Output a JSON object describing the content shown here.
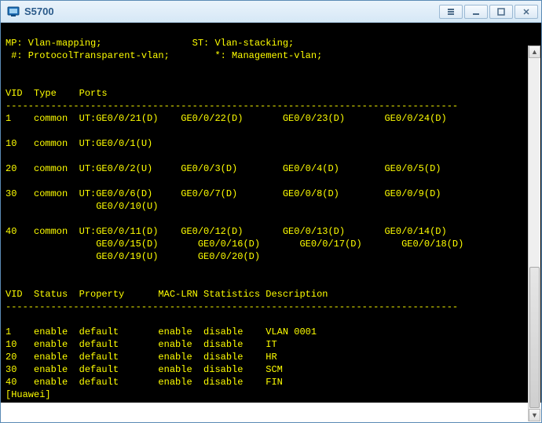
{
  "window": {
    "title": "S5700"
  },
  "legend": {
    "line1_left": "MP: Vlan-mapping;",
    "line1_right": "ST: Vlan-stacking;",
    "line2_left": "#: ProtocolTransparent-vlan;",
    "line2_right": "*: Management-vlan;"
  },
  "table1": {
    "headers": {
      "vid": "VID",
      "type": "Type",
      "ports": "Ports"
    },
    "dash": "--------------------------------------------------------------------------------",
    "rows": [
      {
        "vid": "1",
        "type": "common",
        "ports": [
          [
            "UT:GE0/0/21(D)",
            "GE0/0/22(D)",
            "GE0/0/23(D)",
            "GE0/0/24(D)"
          ]
        ]
      },
      {
        "vid": "10",
        "type": "common",
        "ports": [
          [
            "UT:GE0/0/1(U)"
          ]
        ]
      },
      {
        "vid": "20",
        "type": "common",
        "ports": [
          [
            "UT:GE0/0/2(U)",
            "GE0/0/3(D)",
            "GE0/0/4(D)",
            "GE0/0/5(D)"
          ]
        ]
      },
      {
        "vid": "30",
        "type": "common",
        "ports": [
          [
            "UT:GE0/0/6(D)",
            "GE0/0/7(D)",
            "GE0/0/8(D)",
            "GE0/0/9(D)"
          ],
          [
            "GE0/0/10(U)"
          ]
        ]
      },
      {
        "vid": "40",
        "type": "common",
        "ports": [
          [
            "UT:GE0/0/11(D)",
            "GE0/0/12(D)",
            "GE0/0/13(D)",
            "GE0/0/14(D)"
          ],
          [
            "GE0/0/15(D)",
            "GE0/0/16(D)",
            "GE0/0/17(D)",
            "GE0/0/18(D)"
          ],
          [
            "GE0/0/19(U)",
            "GE0/0/20(D)"
          ]
        ]
      }
    ]
  },
  "table2": {
    "headers": {
      "vid": "VID",
      "status": "Status",
      "property": "Property",
      "maclrn": "MAC-LRN",
      "stats": "Statistics",
      "desc": "Description"
    },
    "dash": "--------------------------------------------------------------------------------",
    "rows": [
      {
        "vid": "1",
        "status": "enable",
        "property": "default",
        "maclrn": "enable",
        "stats": "disable",
        "desc": "VLAN 0001"
      },
      {
        "vid": "10",
        "status": "enable",
        "property": "default",
        "maclrn": "enable",
        "stats": "disable",
        "desc": "IT"
      },
      {
        "vid": "20",
        "status": "enable",
        "property": "default",
        "maclrn": "enable",
        "stats": "disable",
        "desc": "HR"
      },
      {
        "vid": "30",
        "status": "enable",
        "property": "default",
        "maclrn": "enable",
        "stats": "disable",
        "desc": "SCM"
      },
      {
        "vid": "40",
        "status": "enable",
        "property": "default",
        "maclrn": "enable",
        "stats": "disable",
        "desc": "FIN"
      }
    ]
  },
  "prompt": "[Huawei]"
}
